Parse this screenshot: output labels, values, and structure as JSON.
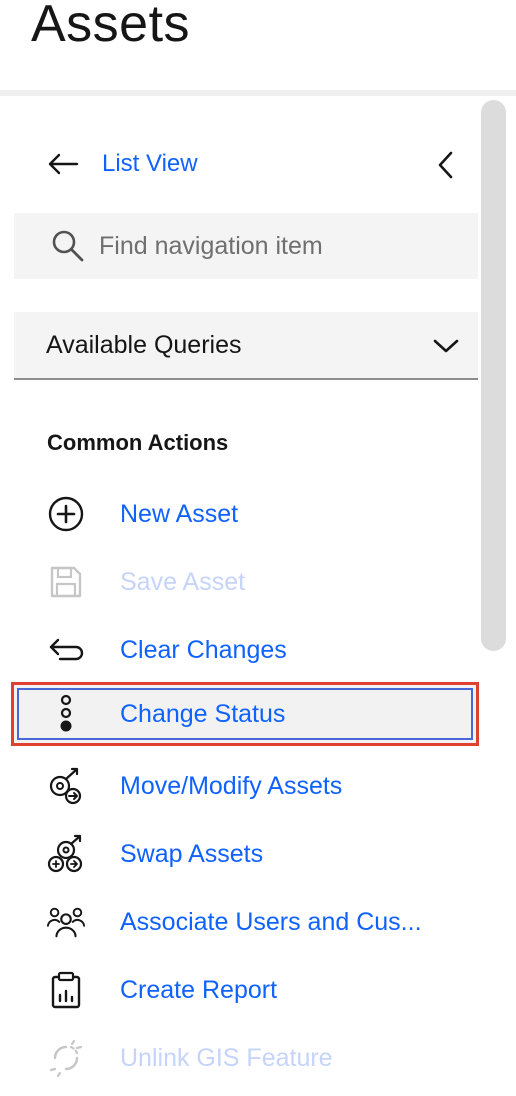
{
  "page": {
    "title": "Assets"
  },
  "nav": {
    "back_label": "List View",
    "search_placeholder": "Find navigation item",
    "queries_label": "Available Queries"
  },
  "common_actions": {
    "heading": "Common Actions",
    "items": [
      {
        "label": "New Asset",
        "icon": "plus-circle-icon",
        "enabled": true
      },
      {
        "label": "Save Asset",
        "icon": "save-icon",
        "enabled": false
      },
      {
        "label": "Clear Changes",
        "icon": "undo-arrow-icon",
        "enabled": true
      },
      {
        "label": "Change Status",
        "icon": "status-dots-icon",
        "enabled": true,
        "selected": true
      },
      {
        "label": "Move/Modify Assets",
        "icon": "move-assets-icon",
        "enabled": true
      },
      {
        "label": "Swap Assets",
        "icon": "swap-assets-icon",
        "enabled": true
      },
      {
        "label": "Associate Users and Cus...",
        "icon": "users-group-icon",
        "enabled": true
      },
      {
        "label": "Create Report",
        "icon": "clipboard-report-icon",
        "enabled": true
      },
      {
        "label": "Unlink GIS Feature",
        "icon": "unlink-icon",
        "enabled": false
      }
    ]
  },
  "colors": {
    "link": "#0f62fe",
    "disabled_link": "#c6d4fb",
    "selection_outline": "#e0402f",
    "field_background": "#f4f4f4"
  }
}
